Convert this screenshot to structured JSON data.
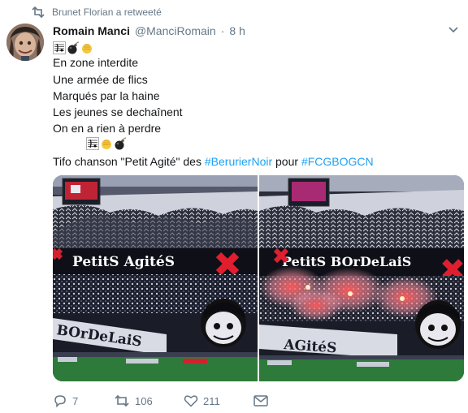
{
  "retweet_context": {
    "text": "Brunet Florian a retweeté",
    "icon": "retweet-icon"
  },
  "tweet": {
    "author_name": "Romain Manci",
    "handle": "@ManciRomain",
    "separator": "·",
    "time": "8 h",
    "lines": [
      "En zone interdite",
      "Une armée de flics",
      "Marqués par la haine",
      "Les jeunes se dechaînent",
      "On en a rien à perdre"
    ],
    "emojis_top": [
      "musical-score-emoji",
      "bomb-emoji",
      "fist-emoji"
    ],
    "emojis_mid": [
      "musical-score-emoji",
      "fist-emoji",
      "bomb-emoji"
    ],
    "tifo_prefix": "Tifo chanson \"Petit Agité\" des ",
    "hashtag_1": "#BerurierNoir",
    "tifo_middle": " pour ",
    "hashtag_2": "#FCGBOGCN",
    "photos": [
      {
        "banner_text": "PetitS AgitéS",
        "lower_text": "BOrDeLaiS"
      },
      {
        "banner_text": "PetitS BOrDeLaiS",
        "lower_text": "AGitéS"
      }
    ]
  },
  "actions": {
    "reply_count": "7",
    "retweet_count": "106",
    "like_count": "211"
  },
  "colors": {
    "link": "#1da1f2",
    "muted": "#657786",
    "text": "#14171a"
  }
}
